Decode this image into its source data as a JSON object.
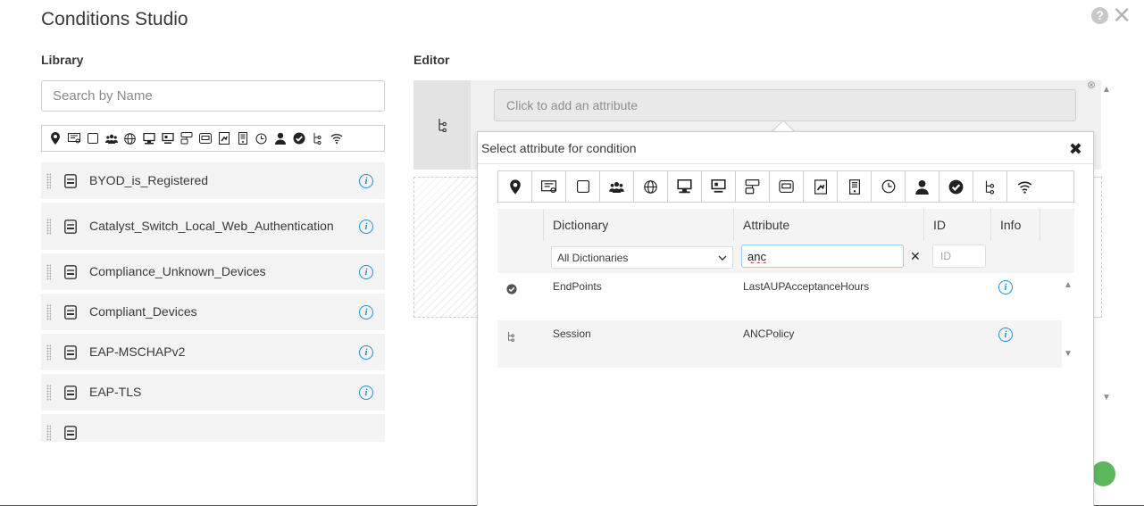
{
  "dialog": {
    "title": "Conditions Studio",
    "help_icon": "question-circle-icon",
    "close_icon": "close-icon"
  },
  "library": {
    "label": "Library",
    "search_placeholder": "Search by Name",
    "icon_filters": [
      "location-icon",
      "identity-card-icon",
      "square-icon",
      "group-icon",
      "globe-icon",
      "computer-icon",
      "monitor-icon",
      "network-device-icon",
      "nic-icon",
      "document-icon",
      "server-icon",
      "clock-icon",
      "user-icon",
      "checkmark-circle-icon",
      "tree-icon",
      "wifi-icon"
    ],
    "items": [
      {
        "name": "BYOD_is_Registered",
        "icon": "condition-icon"
      },
      {
        "name": "Catalyst_Switch_Local_Web_Authentication",
        "icon": "condition-icon"
      },
      {
        "name": "Compliance_Unknown_Devices",
        "icon": "condition-icon"
      },
      {
        "name": "Compliant_Devices",
        "icon": "condition-icon"
      },
      {
        "name": "EAP-MSCHAPv2",
        "icon": "condition-icon"
      },
      {
        "name": "EAP-TLS",
        "icon": "condition-icon"
      },
      {
        "name": "",
        "icon": "condition-icon"
      }
    ]
  },
  "editor": {
    "label": "Editor",
    "add_attribute_placeholder": "Click to add an attribute",
    "attribute_popover": {
      "title": "Select attribute for condition",
      "icon_filters": [
        "location-icon",
        "identity-card-icon",
        "square-icon",
        "group-icon",
        "globe-icon",
        "computer-icon",
        "monitor-icon",
        "network-device-icon",
        "nic-icon",
        "document-icon",
        "server-icon",
        "clock-icon",
        "user-icon",
        "checkmark-circle-icon",
        "tree-icon",
        "wifi-icon"
      ],
      "columns": {
        "dictionary": "Dictionary",
        "attribute": "Attribute",
        "id": "ID",
        "info": "Info"
      },
      "filters": {
        "dictionary_selected": "All Dictionaries",
        "attribute_value": "anc",
        "id_placeholder": "ID"
      },
      "results": [
        {
          "icon": "checkmark-circle-icon",
          "dictionary": "EndPoints",
          "attribute": "LastAUPAcceptanceHours"
        },
        {
          "icon": "tree-icon",
          "dictionary": "Session",
          "attribute": "ANCPolicy"
        }
      ]
    }
  }
}
